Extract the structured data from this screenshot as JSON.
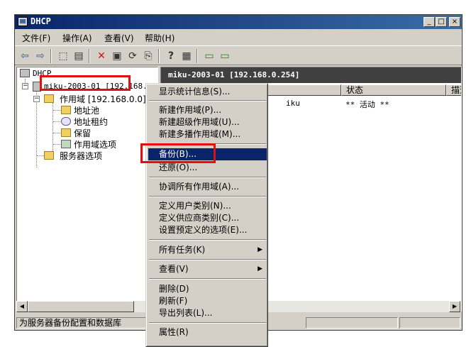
{
  "window": {
    "title": "DHCP",
    "min_label": "_",
    "max_label": "□",
    "close_label": "×"
  },
  "menubar": [
    "文件(F)",
    "操作(A)",
    "查看(V)",
    "帮助(H)"
  ],
  "toolbar": {
    "back": "⇦",
    "forward": "⇨",
    "up": "⬚",
    "tree": "▤",
    "delete": "✕",
    "properties": "▣",
    "refresh": "⟳",
    "export": "⎘",
    "help": "?",
    "console": "▦",
    "monitor1": "▭",
    "monitor2": "▭"
  },
  "tree": {
    "root": "DHCP",
    "server": "miku-2003-01 [192.168.0.254]",
    "scope": "作用域 [192.168.0.0]",
    "children": [
      "地址池",
      "地址租约",
      "保留",
      "作用域选项"
    ],
    "server_options": "服务器选项"
  },
  "right_pane": {
    "header": "miku-2003-01 [192.168.0.254]",
    "columns": [
      "状态",
      "描述"
    ],
    "row": {
      "name": "iku",
      "status": "** 活动 **"
    }
  },
  "context_menu": {
    "items": [
      "显示统计信息(S)...",
      "新建作用域(P)...",
      "新建超级作用域(U)...",
      "新建多播作用域(M)...",
      "备份(B)...",
      "还原(O)...",
      "协调所有作用域(A)...",
      "定义用户类别(N)...",
      "定义供应商类别(C)...",
      "设置预定义的选项(E)...",
      "所有任务(K)",
      "查看(V)",
      "删除(D)",
      "刷新(F)",
      "导出列表(L)...",
      "属性(R)"
    ],
    "arrow": "▶"
  },
  "scroll": {
    "left": "◀",
    "right": "▶"
  },
  "status_bar": {
    "text": "为服务器备份配置和数据库"
  },
  "colors": {
    "highlight": "#e01010",
    "selection": "#0a246a",
    "titlebar": "#0a246a"
  }
}
